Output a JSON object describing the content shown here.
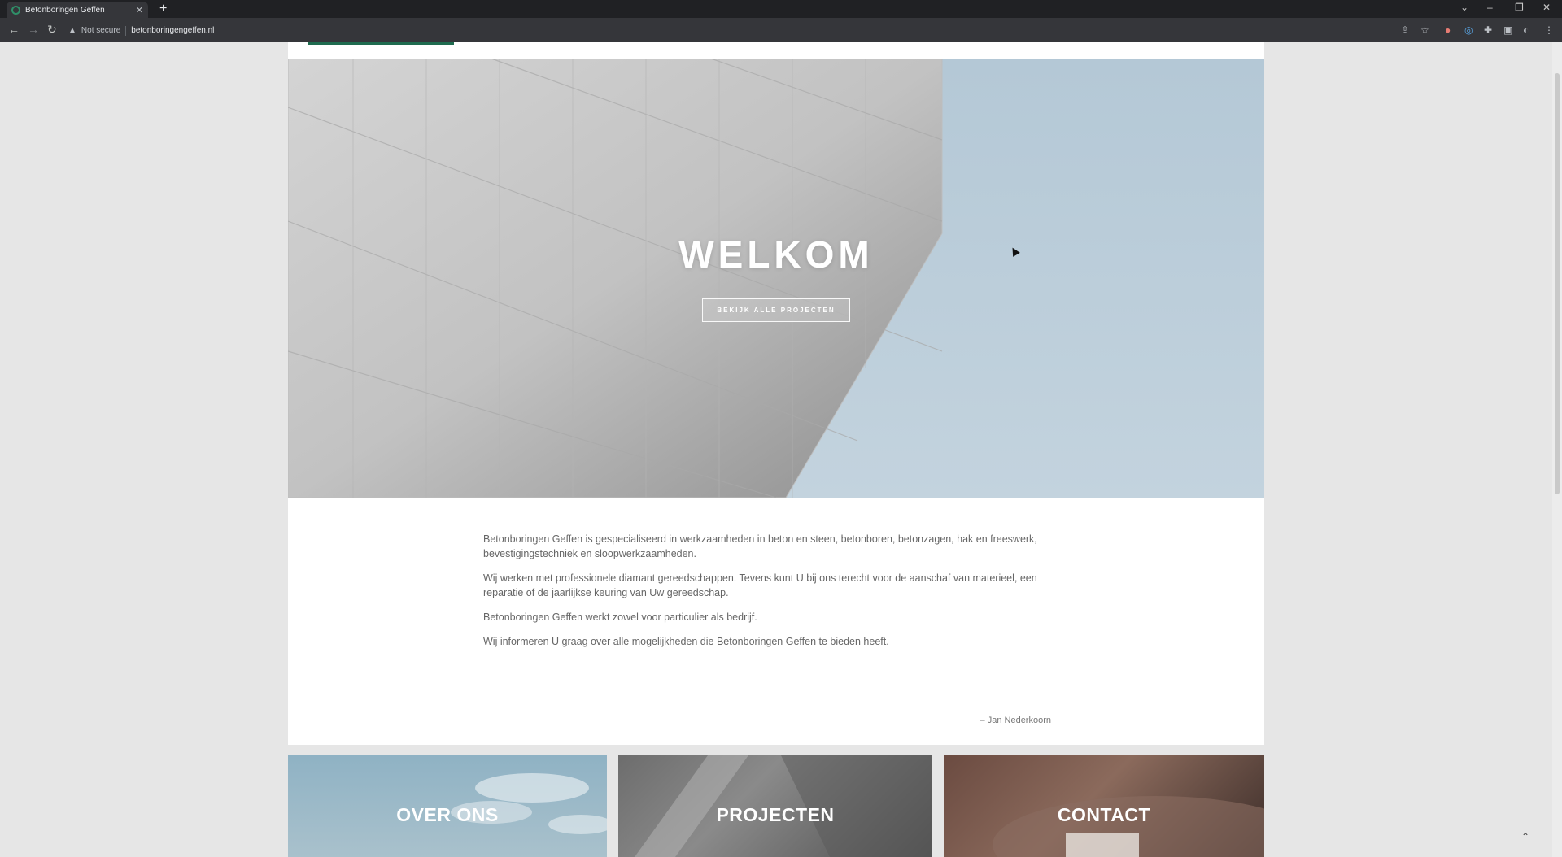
{
  "browser": {
    "tab_title": "Betonboringen Geffen",
    "security_label": "Not secure",
    "url": "betonboringengeffen.nl"
  },
  "hero": {
    "title": "WELKOM",
    "button_label": "BEKIJK ALLE PROJECTEN"
  },
  "intro": {
    "paragraphs": [
      "Betonboringen Geffen is gespecialiseerd in werkzaamheden in beton en steen, betonboren, betonzagen, hak en freeswerk, bevestigingstechniek en sloopwerkzaamheden.",
      "Wij werken met professionele diamant gereedschappen. Tevens kunt U bij ons terecht voor de aanschaf van materieel, een reparatie of de jaarlijkse keuring van Uw gereedschap.",
      "Betonboringen Geffen werkt zowel voor particulier als bedrijf.",
      "Wij informeren U graag over alle mogelijkheden die Betonboringen Geffen te bieden heeft."
    ],
    "signature": "– Jan Nederkoorn"
  },
  "cards": {
    "about": "OVER ONS",
    "projects": "PROJECTEN",
    "contact": "CONTACT"
  },
  "colors": {
    "brand_green": "#1f6b4f",
    "sky": "#b6c9d6",
    "text_gray": "#666666"
  }
}
